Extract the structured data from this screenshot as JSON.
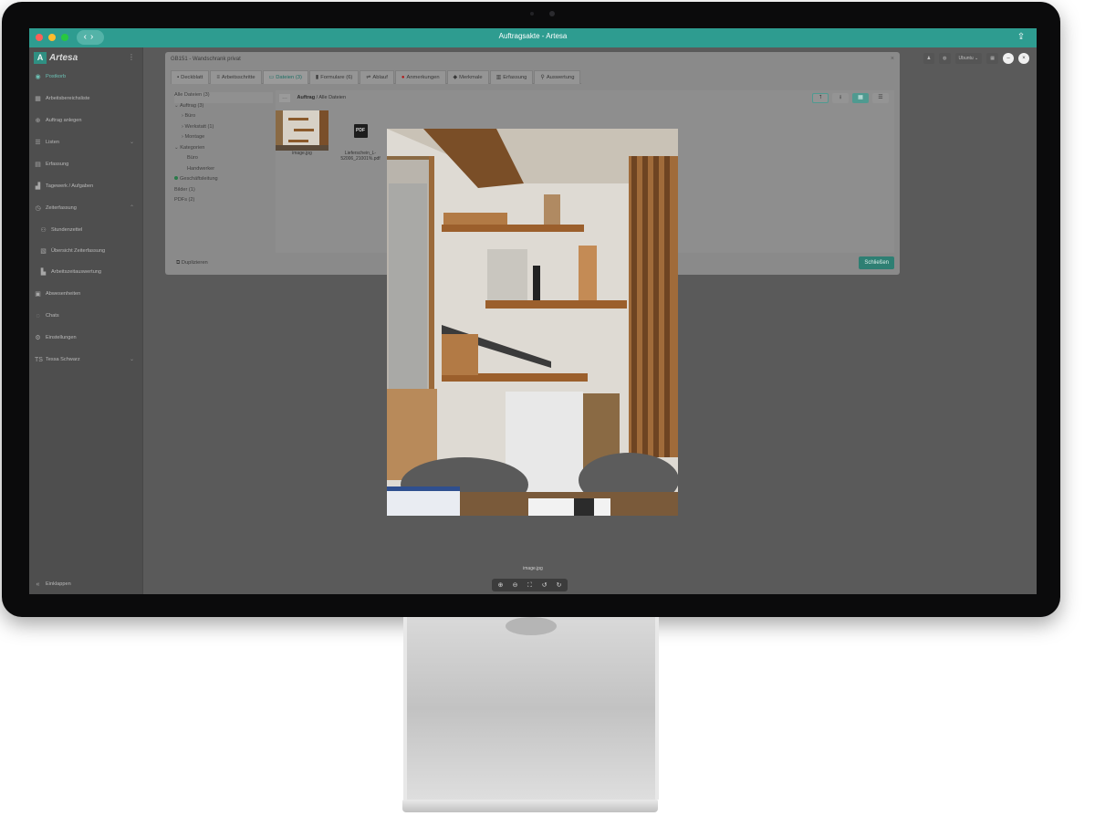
{
  "window": {
    "title": "Auftragsakte - Artesa"
  },
  "app": {
    "logo_mark": "A",
    "logo_text": "Artesa"
  },
  "sidebar": {
    "items": [
      {
        "label": "Postkorb",
        "icon": "inbox-icon",
        "active": true
      },
      {
        "label": "Arbeitsbereichsliste",
        "icon": "calendar-icon"
      },
      {
        "label": "Auftrag anlegen",
        "icon": "plus-circle-icon"
      },
      {
        "label": "Listen",
        "icon": "list-icon"
      },
      {
        "label": "Erfassung",
        "icon": "clipboard-icon"
      },
      {
        "label": "Tagewerk / Aufgaben",
        "icon": "chart-icon"
      },
      {
        "label": "Zeiterfassung",
        "icon": "clock-icon"
      },
      {
        "label": "Stundenzettel",
        "icon": "people-icon",
        "sub": true
      },
      {
        "label": "Übersicht Zeiterfassung",
        "icon": "table-icon",
        "sub": true
      },
      {
        "label": "Arbeitszeitauswertung",
        "icon": "report-icon",
        "sub": true
      },
      {
        "label": "Abwesenheiten",
        "icon": "calendar-x-icon"
      },
      {
        "label": "Chats",
        "icon": "chat-icon"
      },
      {
        "label": "Einstellungen",
        "icon": "gear-icon"
      },
      {
        "label": "Tessa Schwarz",
        "icon": "user-icon"
      }
    ],
    "footer": "Einklappen"
  },
  "topbar": {
    "user_chip": "Ubuntu"
  },
  "dialog": {
    "title": "GB151 - Wandschrank privat",
    "tabs": [
      {
        "label": "Deckblatt",
        "icon": "document-icon"
      },
      {
        "label": "Arbeitsschritte",
        "icon": "steps-icon"
      },
      {
        "label": "Dateien (3)",
        "icon": "folder-icon",
        "active": true
      },
      {
        "label": "Formulare (6)",
        "icon": "form-icon"
      },
      {
        "label": "Ablauf",
        "icon": "flow-icon"
      },
      {
        "label": "Anmerkungen",
        "icon": "alert-icon"
      },
      {
        "label": "Merkmale",
        "icon": "tag-icon"
      },
      {
        "label": "Erfassung",
        "icon": "printer-icon"
      },
      {
        "label": "Auswertung",
        "icon": "search-icon"
      }
    ],
    "tree": [
      {
        "label": "Alle Dateien (3)",
        "indent": 0,
        "selected": true
      },
      {
        "label": "Auftrag (3)",
        "indent": 0,
        "caret": "⌄"
      },
      {
        "label": "Büro",
        "indent": 1,
        "caret": "›"
      },
      {
        "label": "Werkstatt (1)",
        "indent": 1,
        "caret": "›"
      },
      {
        "label": "Montage",
        "indent": 1,
        "caret": "›"
      },
      {
        "label": "Kategorien",
        "indent": 0,
        "caret": "⌄"
      },
      {
        "label": "Büro",
        "indent": 1
      },
      {
        "label": "Handwerker",
        "indent": 1
      },
      {
        "label": "Geschäftsleitung",
        "indent": 0,
        "dot": true
      },
      {
        "label": "Bilder (1)",
        "indent": 0
      },
      {
        "label": "PDFs (2)",
        "indent": 0
      }
    ],
    "breadcrumb": {
      "root": "Auftrag",
      "sep": "/",
      "current": "Alle Dateien",
      "back": "…"
    },
    "files": [
      {
        "name": "image.jpg",
        "kind": "image"
      },
      {
        "name": "Lieferschein_L-52006_21001%.pdf",
        "kind": "pdf",
        "badge": "PDF"
      }
    ],
    "footer_left": "Duplizieren",
    "close_label": "Schließen"
  },
  "preview": {
    "caption": "image.jpg"
  }
}
